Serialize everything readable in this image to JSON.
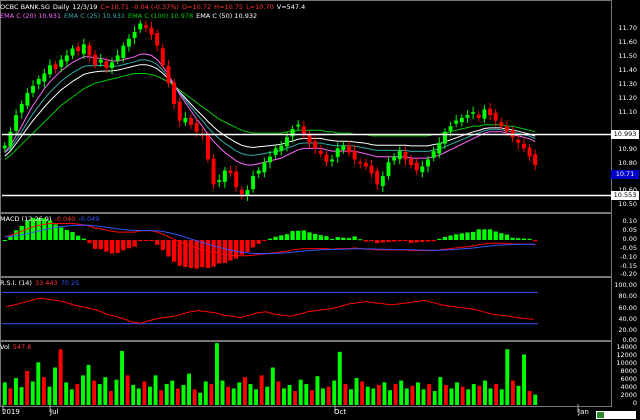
{
  "header": {
    "symbol": "OCBC BANK.SG",
    "period": "Daily",
    "date": "12/3/19",
    "close": "C=10.71",
    "change": "-0.04 (-0.37%)",
    "open": "O=10.72",
    "high": "H=10.75",
    "low": "L=10.70",
    "volume": "V=547.4"
  },
  "ema_legend": {
    "ema20": "EMA C (20) 10.931",
    "ema25": "EMA C (25) 10.931",
    "ema100": "EMA C (100) 10.978",
    "ema50": "EMA C (50) 10.932"
  },
  "price_panel": {
    "ticks": [
      "11.70",
      "11.60",
      "11.50",
      "11.40",
      "11.30",
      "11.20",
      "11.10",
      "10.90",
      "10.80",
      "10.60",
      "10.50"
    ],
    "tag_hline": "10.993",
    "tag_last": "10.71",
    "tag_lower": "10.553"
  },
  "macd_panel": {
    "label": "MACD (12,26,9)",
    "value1": "-0.040",
    "value2": "-0.049",
    "ticks": [
      "0.10",
      "0.05",
      "0.00",
      "-0.05",
      "-0.10",
      "-0.15",
      "-0.20"
    ]
  },
  "rsi_panel": {
    "label": "R.S.I. (14)",
    "value": "33.443",
    "extra": "70  25",
    "ticks": [
      "100.00",
      "80.00",
      "60.00",
      "40.00",
      "20.00",
      "0.00"
    ]
  },
  "vol_panel": {
    "label": "Vol",
    "value": "547.8",
    "ticks": [
      "14000",
      "12000",
      "10000",
      "8000",
      "6000",
      "4000",
      "2000",
      "0"
    ]
  },
  "x_axis": [
    "2019",
    "Jul",
    "Oct",
    "Jan"
  ],
  "colors": {
    "up": "#00ff00",
    "down": "#ff0000",
    "ema_green": "#00cc00",
    "ema_pink": "#ff66ff",
    "ema_white": "#ffffff",
    "ema_teal": "#33aaaa",
    "rsi": "#ff0000",
    "macd_line": "#ff0000",
    "signal_line": "#3355ff"
  },
  "chart_data": {
    "type": "candlestick",
    "closes": [
      10.9,
      11.0,
      11.12,
      11.2,
      11.28,
      11.33,
      11.38,
      11.42,
      11.48,
      11.45,
      11.52,
      11.55,
      11.6,
      11.58,
      11.63,
      11.55,
      11.48,
      11.52,
      11.46,
      11.5,
      11.55,
      11.62,
      11.67,
      11.72,
      11.78,
      11.75,
      11.7,
      11.62,
      11.48,
      11.35,
      11.2,
      11.08,
      11.1,
      11.05,
      11.0,
      10.98,
      10.8,
      10.62,
      10.65,
      10.72,
      10.7,
      10.6,
      10.55,
      10.58,
      10.68,
      10.72,
      10.78,
      10.82,
      10.88,
      10.9,
      10.96,
      11.02,
      11.05,
      10.98,
      10.92,
      10.88,
      10.84,
      10.78,
      10.8,
      10.88,
      10.9,
      10.85,
      10.8,
      10.78,
      10.75,
      10.7,
      10.62,
      10.68,
      10.78,
      10.82,
      10.86,
      10.8,
      10.76,
      10.72,
      10.75,
      10.8,
      10.86,
      10.92,
      11.0,
      11.04,
      11.08,
      11.1,
      11.12,
      11.14,
      11.1,
      11.16,
      11.12,
      11.08,
      11.04,
      11.0,
      10.96,
      10.92,
      10.88,
      10.82,
      10.76
    ],
    "ema20": [
      10.85,
      10.9,
      10.97,
      11.04,
      11.12,
      11.19,
      11.25,
      11.31,
      11.36,
      11.4,
      11.44,
      11.47,
      11.5,
      11.52,
      11.54,
      11.54,
      11.53,
      11.53,
      11.52,
      11.51,
      11.51,
      11.52,
      11.53,
      11.54,
      11.56,
      11.56,
      11.55,
      11.52,
      11.47,
      11.41,
      11.34,
      11.27,
      11.21,
      11.15,
      11.09,
      11.04,
      10.98,
      10.93,
      10.89,
      10.85,
      10.82,
      10.79,
      10.77,
      10.76,
      10.76,
      10.77,
      10.78,
      10.79,
      10.8,
      10.81,
      10.83,
      10.85,
      10.87,
      10.88,
      10.88,
      10.88,
      10.88,
      10.87,
      10.86,
      10.86,
      10.86,
      10.86,
      10.86,
      10.85,
      10.84,
      10.83,
      10.82,
      10.82,
      10.82,
      10.82,
      10.82,
      10.82,
      10.81,
      10.81,
      10.81,
      10.81,
      10.82,
      10.83,
      10.85,
      10.87,
      10.89,
      10.91,
      10.93,
      10.95,
      10.97,
      10.99,
      11.0,
      11.0,
      11.0,
      10.99,
      10.98,
      10.97,
      10.96,
      10.95,
      10.93
    ],
    "ema100": [
      10.8,
      10.83,
      10.87,
      10.91,
      10.95,
      10.99,
      11.03,
      11.07,
      11.11,
      11.15,
      11.19,
      11.22,
      11.25,
      11.28,
      11.31,
      11.33,
      11.35,
      11.36,
      11.37,
      11.38,
      11.39,
      11.4,
      11.41,
      11.42,
      11.42,
      11.42,
      11.41,
      11.4,
      11.38,
      11.36,
      11.33,
      11.3,
      11.27,
      11.24,
      11.21,
      11.18,
      11.15,
      11.12,
      11.09,
      11.07,
      11.05,
      11.03,
      11.01,
      11.0,
      10.99,
      10.99,
      10.99,
      10.99,
      10.99,
      10.99,
      11.0,
      11.0,
      11.01,
      11.01,
      11.01,
      11.01,
      11.01,
      11.0,
      11.0,
      10.99,
      10.99,
      10.99,
      10.98,
      10.98,
      10.98,
      10.97,
      10.97,
      10.97,
      10.97,
      10.97,
      10.97,
      10.97,
      10.97,
      10.97,
      10.97,
      10.97,
      10.98,
      10.98,
      10.99,
      11.0,
      11.01,
      11.02,
      11.03,
      11.04,
      11.04,
      11.05,
      11.05,
      11.05,
      11.05,
      11.04,
      11.04,
      11.03,
      11.02,
      11.01,
      11.0
    ],
    "rsi": [
      55,
      58,
      62,
      66,
      70,
      68,
      66,
      63,
      58,
      55,
      52,
      48,
      42,
      38,
      34,
      28,
      26,
      30,
      34,
      36,
      38,
      42,
      46,
      48,
      46,
      44,
      40,
      38,
      36,
      40,
      44,
      46,
      42,
      40,
      38,
      42,
      46,
      48,
      50,
      52,
      56,
      60,
      62,
      64,
      62,
      60,
      58,
      60,
      62,
      64,
      66,
      62,
      58,
      56,
      54,
      52,
      50,
      46,
      42,
      40,
      38,
      36,
      34,
      33
    ],
    "volume": [
      5200,
      3800,
      6200,
      4100,
      7800,
      5400,
      9800,
      6400,
      4200,
      8600,
      12800,
      5200,
      3600,
      4800,
      6800,
      9200,
      5600,
      4800,
      6400,
      3200,
      5800,
      12400,
      6800,
      4600,
      3800,
      5400,
      4200,
      6800,
      3400,
      4800,
      5600,
      3800,
      4600,
      7200,
      3600,
      2800,
      5400,
      4800,
      14200,
      5600,
      4200,
      3800,
      5200,
      6400,
      4800,
      3600,
      6800,
      4200,
      8600,
      5400,
      3800,
      4600,
      3200,
      5800,
      4800,
      3400,
      6600,
      3800,
      4200,
      5600,
      12200,
      4800,
      3600,
      6200,
      5400,
      4200,
      3800,
      4600,
      5200,
      3400,
      4800,
      5600,
      3800,
      4400,
      5200,
      3600,
      4800,
      3200,
      6400,
      4600,
      3800,
      5200,
      4200,
      3600,
      4800,
      4400,
      5600,
      3800,
      4800,
      3600,
      12800,
      5600,
      4400,
      11600,
      3200,
      2400
    ]
  }
}
